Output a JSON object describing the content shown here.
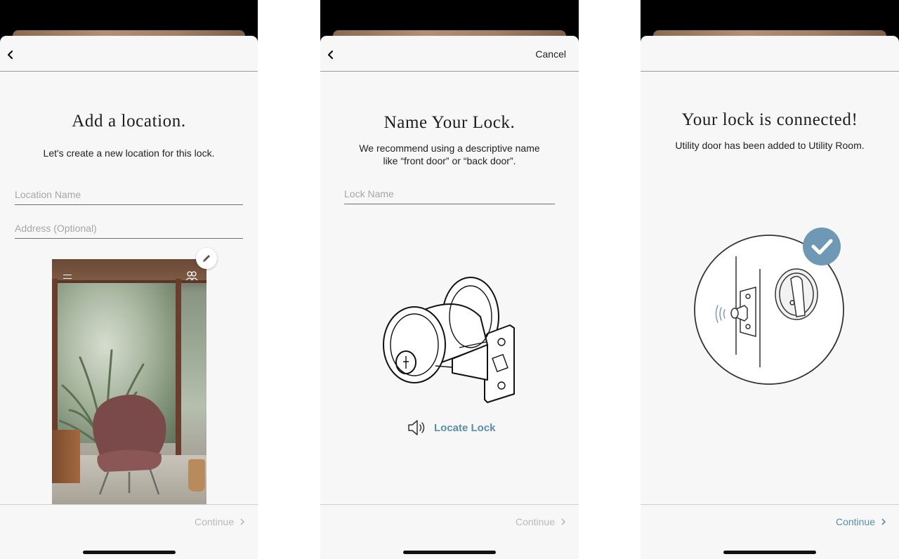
{
  "screens": [
    {
      "title": "Add a location.",
      "subtitle": "Let's create a new location for this lock.",
      "location_name_placeholder": "Location Name",
      "address_placeholder": "Address (Optional)",
      "continue_label": "Continue",
      "continue_enabled": false
    },
    {
      "cancel_label": "Cancel",
      "title": "Name Your Lock.",
      "subtitle": "We recommend using a descriptive name like “front door” or “back door”.",
      "lock_name_placeholder": "Lock Name",
      "locate_label": "Locate Lock",
      "continue_label": "Continue",
      "continue_enabled": false
    },
    {
      "title": "Your lock is connected!",
      "subtitle": "Utility door has been added to Utility Room.",
      "continue_label": "Continue",
      "continue_enabled": true
    }
  ],
  "colors": {
    "accent": "#5a8dae",
    "disabled": "#b9b9b9",
    "background": "#f6f7f6",
    "check_badge": "#6f98b4"
  },
  "icons": [
    "back-arrow-icon",
    "pencil-icon",
    "menu-icon",
    "users-icon",
    "speaker-icon",
    "chevron-right-icon",
    "checkmark-icon"
  ]
}
